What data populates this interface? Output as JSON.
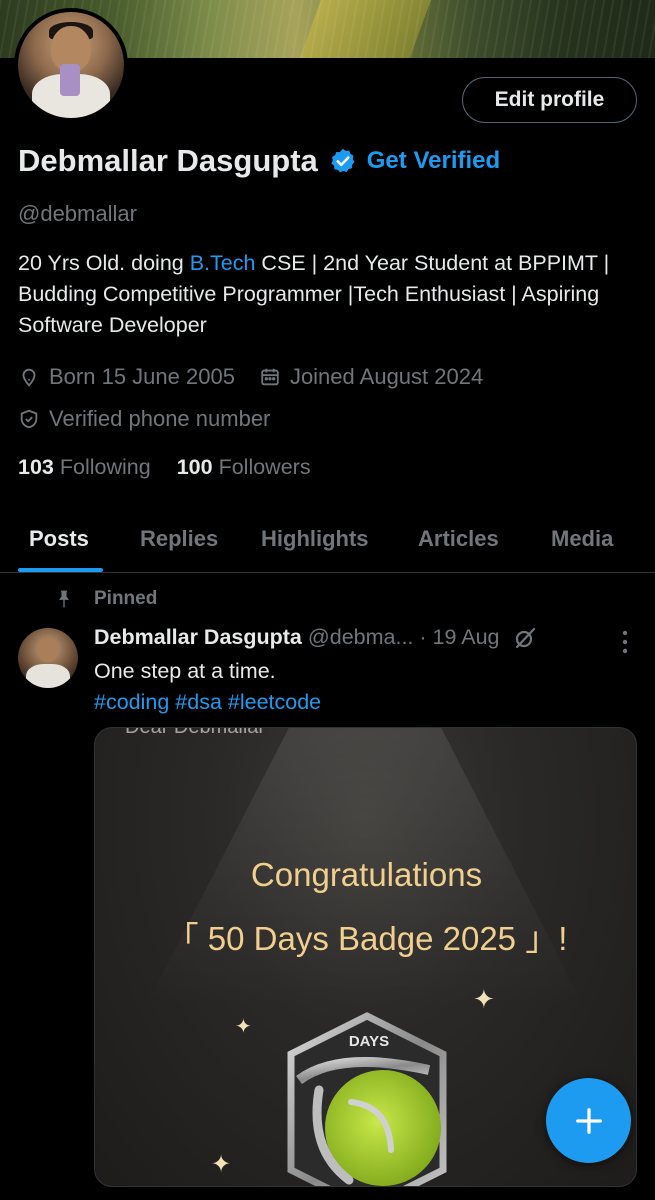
{
  "profile": {
    "name": "Debmallar Dasgupta",
    "get_verified": "Get Verified",
    "handle": "@debmallar",
    "edit_label": "Edit profile",
    "bio": {
      "part1": "20 Yrs Old. doing ",
      "link": "B.Tech",
      "part2": " CSE | 2nd Year Student at BPPIMT | Budding Competitive Programmer |Tech Enthusiast | Aspiring Software Developer"
    },
    "born": "Born 15 June 2005",
    "joined": "Joined August 2024",
    "verified_phone": "Verified phone number",
    "following_count": "103",
    "following_label": "Following",
    "followers_count": "100",
    "followers_label": "Followers"
  },
  "tabs": [
    "Posts",
    "Replies",
    "Highlights",
    "Articles",
    "Media"
  ],
  "active_tab": "Posts",
  "post": {
    "pinned_label": "Pinned",
    "author": "Debmallar Dasgupta",
    "handle": "@debma...",
    "time": "· 19 Aug",
    "text": "One step at a time.",
    "hashtags": "#coding #dsa #leetcode",
    "media": {
      "dear_text": "Dear Debmallar",
      "congrats": "Congratulations",
      "badge_text": "「 50 Days Badge 2025 」!",
      "badge_label": "DAYS"
    }
  },
  "icons": {
    "verified": "verified-badge-icon",
    "location": "location-pin-icon",
    "calendar": "calendar-icon",
    "shield": "shield-check-icon",
    "pin": "pin-icon",
    "grok": "grok-icon",
    "more": "more-vertical-icon",
    "compose": "plus-icon"
  },
  "colors": {
    "accent": "#1d9bf0",
    "background": "#000000",
    "text": "#e7e9ea",
    "muted": "#71767b",
    "gold": "#f1d08f"
  }
}
